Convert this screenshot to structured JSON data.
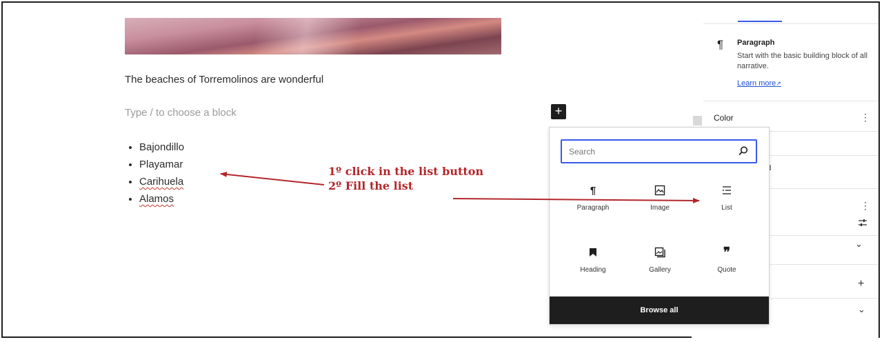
{
  "editor": {
    "paragraph": "The beaches of Torremolinos are wonderful",
    "placeholder": "Type / to choose a block",
    "inserter_symbol": "+",
    "list_items": [
      "Bajondillo",
      "Playamar",
      "Carihuela",
      "Alamos"
    ]
  },
  "annotation": {
    "line1": "1º click in the list button",
    "line2": "2º Fill the list",
    "color": "#b3262a"
  },
  "sidebar": {
    "block_icon": "paragraph-icon",
    "block_title": "Paragraph",
    "block_description": "Start with the basic building block of all narrative.",
    "learn_more": "Learn more",
    "color_label": "Color",
    "partial_text": "und",
    "kebab": "⋮",
    "plus": "+",
    "chevron": "⌄"
  },
  "inserter": {
    "search_placeholder": "Search",
    "blocks": [
      {
        "label": "Paragraph",
        "icon": "paragraph-icon"
      },
      {
        "label": "Image",
        "icon": "image-icon"
      },
      {
        "label": "List",
        "icon": "list-icon"
      },
      {
        "label": "Heading",
        "icon": "heading-icon"
      },
      {
        "label": "Gallery",
        "icon": "gallery-icon"
      },
      {
        "label": "Quote",
        "icon": "quote-icon"
      }
    ],
    "browse_all": "Browse all"
  },
  "colors": {
    "accent": "#3858e9",
    "dark": "#1e1e1e"
  }
}
